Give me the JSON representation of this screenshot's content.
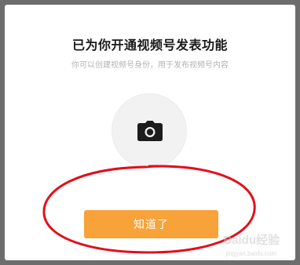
{
  "dialog": {
    "title": "已为你开通视频号发表功能",
    "subtitle": "你可以创建视频号身份，用于发布视频号内容",
    "avatar_icon": "camera-icon",
    "ok_label": "知道了"
  },
  "watermark": {
    "text": "Baidu经验",
    "url": "jingyan.baidu.com"
  },
  "colors": {
    "accent": "#f8a23a",
    "annotation": "#e30f1b",
    "backdrop": "#6f6f6f"
  }
}
